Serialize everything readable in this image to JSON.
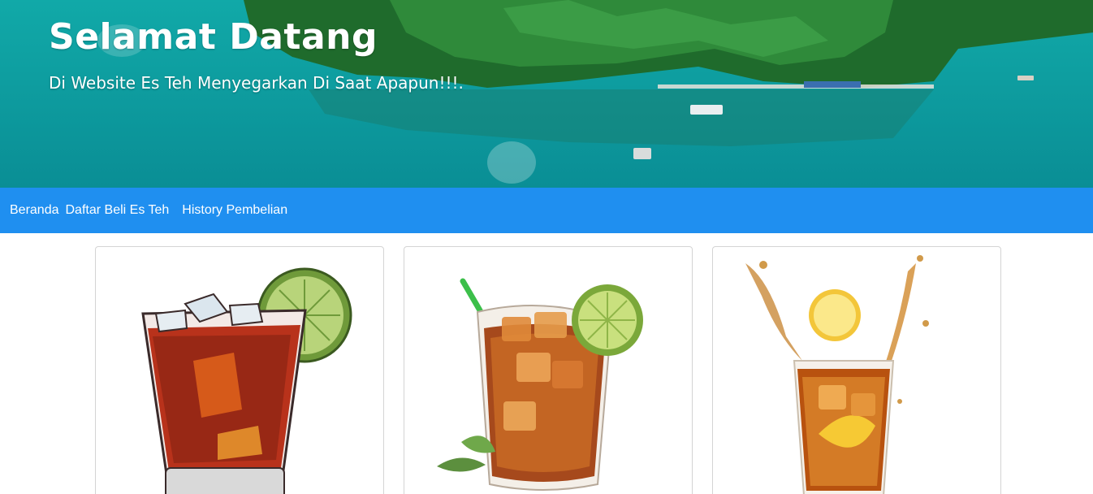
{
  "hero": {
    "title": "Selamat Datang",
    "subtitle": "Di Website Es Teh Menyegarkan Di Saat Apapun!!!."
  },
  "nav": {
    "items": [
      {
        "label": "Beranda"
      },
      {
        "label": "Daftar Beli Es Teh"
      },
      {
        "label": "History Pembelian"
      }
    ],
    "background": "#1f8ff0"
  },
  "products": [
    {
      "image": "iced-tea-sketch-image"
    },
    {
      "image": "iced-tea-lime-image"
    },
    {
      "image": "iced-tea-splash-image"
    }
  ]
}
